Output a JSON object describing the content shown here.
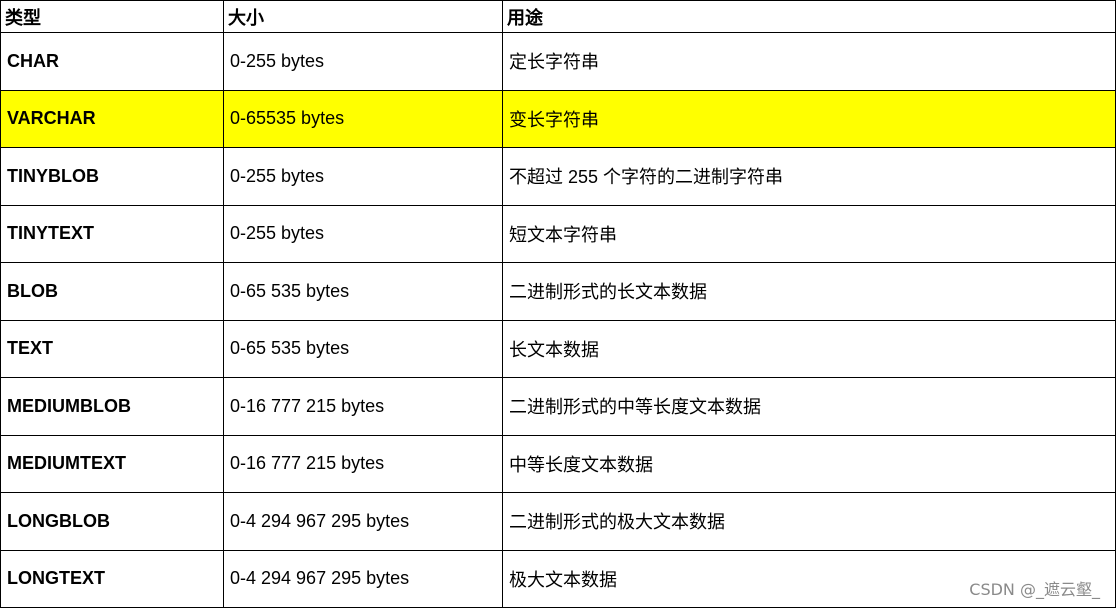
{
  "header": {
    "col_type": "类型",
    "col_size": "大小",
    "col_usage": "用途"
  },
  "highlight_color": "#ffff00",
  "rows": [
    {
      "type": "CHAR",
      "size": "0-255 bytes",
      "usage": "定长字符串",
      "highlighted": false
    },
    {
      "type": "VARCHAR",
      "size": "0-65535 bytes",
      "usage": "变长字符串",
      "highlighted": true
    },
    {
      "type": "TINYBLOB",
      "size": "0-255 bytes",
      "usage": "不超过 255 个字符的二进制字符串",
      "highlighted": false
    },
    {
      "type": "TINYTEXT",
      "size": "0-255 bytes",
      "usage": "短文本字符串",
      "highlighted": false
    },
    {
      "type": "BLOB",
      "size": "0-65 535 bytes",
      "usage": "二进制形式的长文本数据",
      "highlighted": false
    },
    {
      "type": "TEXT",
      "size": "0-65 535 bytes",
      "usage": "长文本数据",
      "highlighted": false
    },
    {
      "type": "MEDIUMBLOB",
      "size": "0-16 777 215 bytes",
      "usage": "二进制形式的中等长度文本数据",
      "highlighted": false
    },
    {
      "type": "MEDIUMTEXT",
      "size": "0-16 777 215 bytes",
      "usage": "中等长度文本数据",
      "highlighted": false
    },
    {
      "type": "LONGBLOB",
      "size": "0-4 294 967 295 bytes",
      "usage": "二进制形式的极大文本数据",
      "highlighted": false
    },
    {
      "type": "LONGTEXT",
      "size": "0-4 294 967 295 bytes",
      "usage": "极大文本数据",
      "highlighted": false
    }
  ],
  "watermark": "CSDN @_遮云壑_"
}
